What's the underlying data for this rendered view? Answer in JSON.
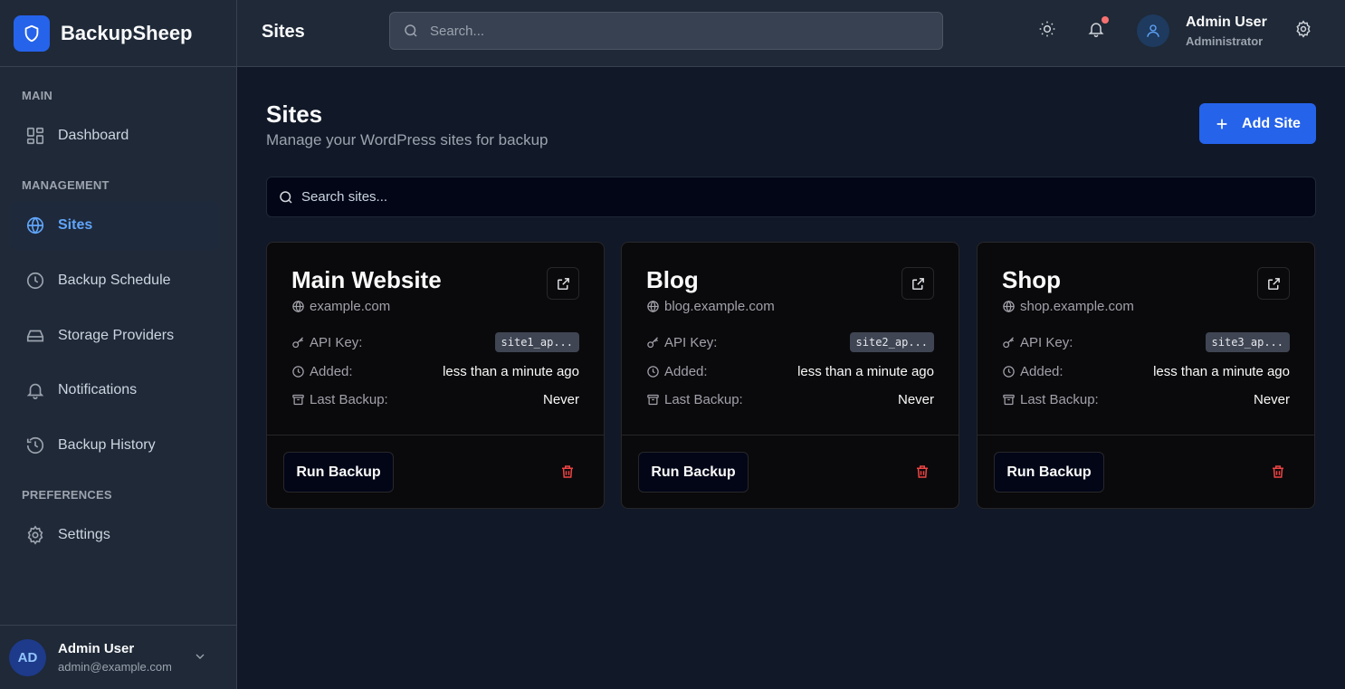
{
  "brand": {
    "name": "BackupSheep",
    "icon": "shield-icon",
    "accent": "#2563eb"
  },
  "sidebar": {
    "sections": [
      {
        "label": "MAIN"
      },
      {
        "label": "MANAGEMENT"
      },
      {
        "label": "PREFERENCES"
      }
    ],
    "items": [
      {
        "label": "Dashboard",
        "icon": "dashboard-icon"
      },
      {
        "label": "Sites",
        "icon": "globe-icon",
        "active": true
      },
      {
        "label": "Backup Schedule",
        "icon": "clock-icon"
      },
      {
        "label": "Storage Providers",
        "icon": "hard-drive-icon"
      },
      {
        "label": "Notifications",
        "icon": "bell-icon"
      },
      {
        "label": "Backup History",
        "icon": "history-icon"
      },
      {
        "label": "Settings",
        "icon": "gear-icon"
      }
    ],
    "user": {
      "initials": "AD",
      "name": "Admin User",
      "email": "admin@example.com"
    }
  },
  "header": {
    "title": "Sites",
    "search_placeholder": "Search...",
    "user": {
      "name": "Admin User",
      "role": "Administrator"
    },
    "has_notification": true
  },
  "main": {
    "title": "Sites",
    "subtitle": "Manage your WordPress sites for backup",
    "add_button": "Add Site",
    "search_placeholder": "Search sites...",
    "labels": {
      "api_key": "API Key:",
      "added": "Added:",
      "last_backup": "Last Backup:",
      "run_backup": "Run Backup"
    },
    "sites": [
      {
        "name": "Main Website",
        "url": "example.com",
        "api_key": "site1_ap...",
        "added": "less than a minute ago",
        "last_backup": "Never"
      },
      {
        "name": "Blog",
        "url": "blog.example.com",
        "api_key": "site2_ap...",
        "added": "less than a minute ago",
        "last_backup": "Never"
      },
      {
        "name": "Shop",
        "url": "shop.example.com",
        "api_key": "site3_ap...",
        "added": "less than a minute ago",
        "last_backup": "Never"
      }
    ]
  },
  "colors": {
    "danger": "#ef4444",
    "active_nav": "#60a5fa",
    "notification_dot": "#f87171"
  }
}
